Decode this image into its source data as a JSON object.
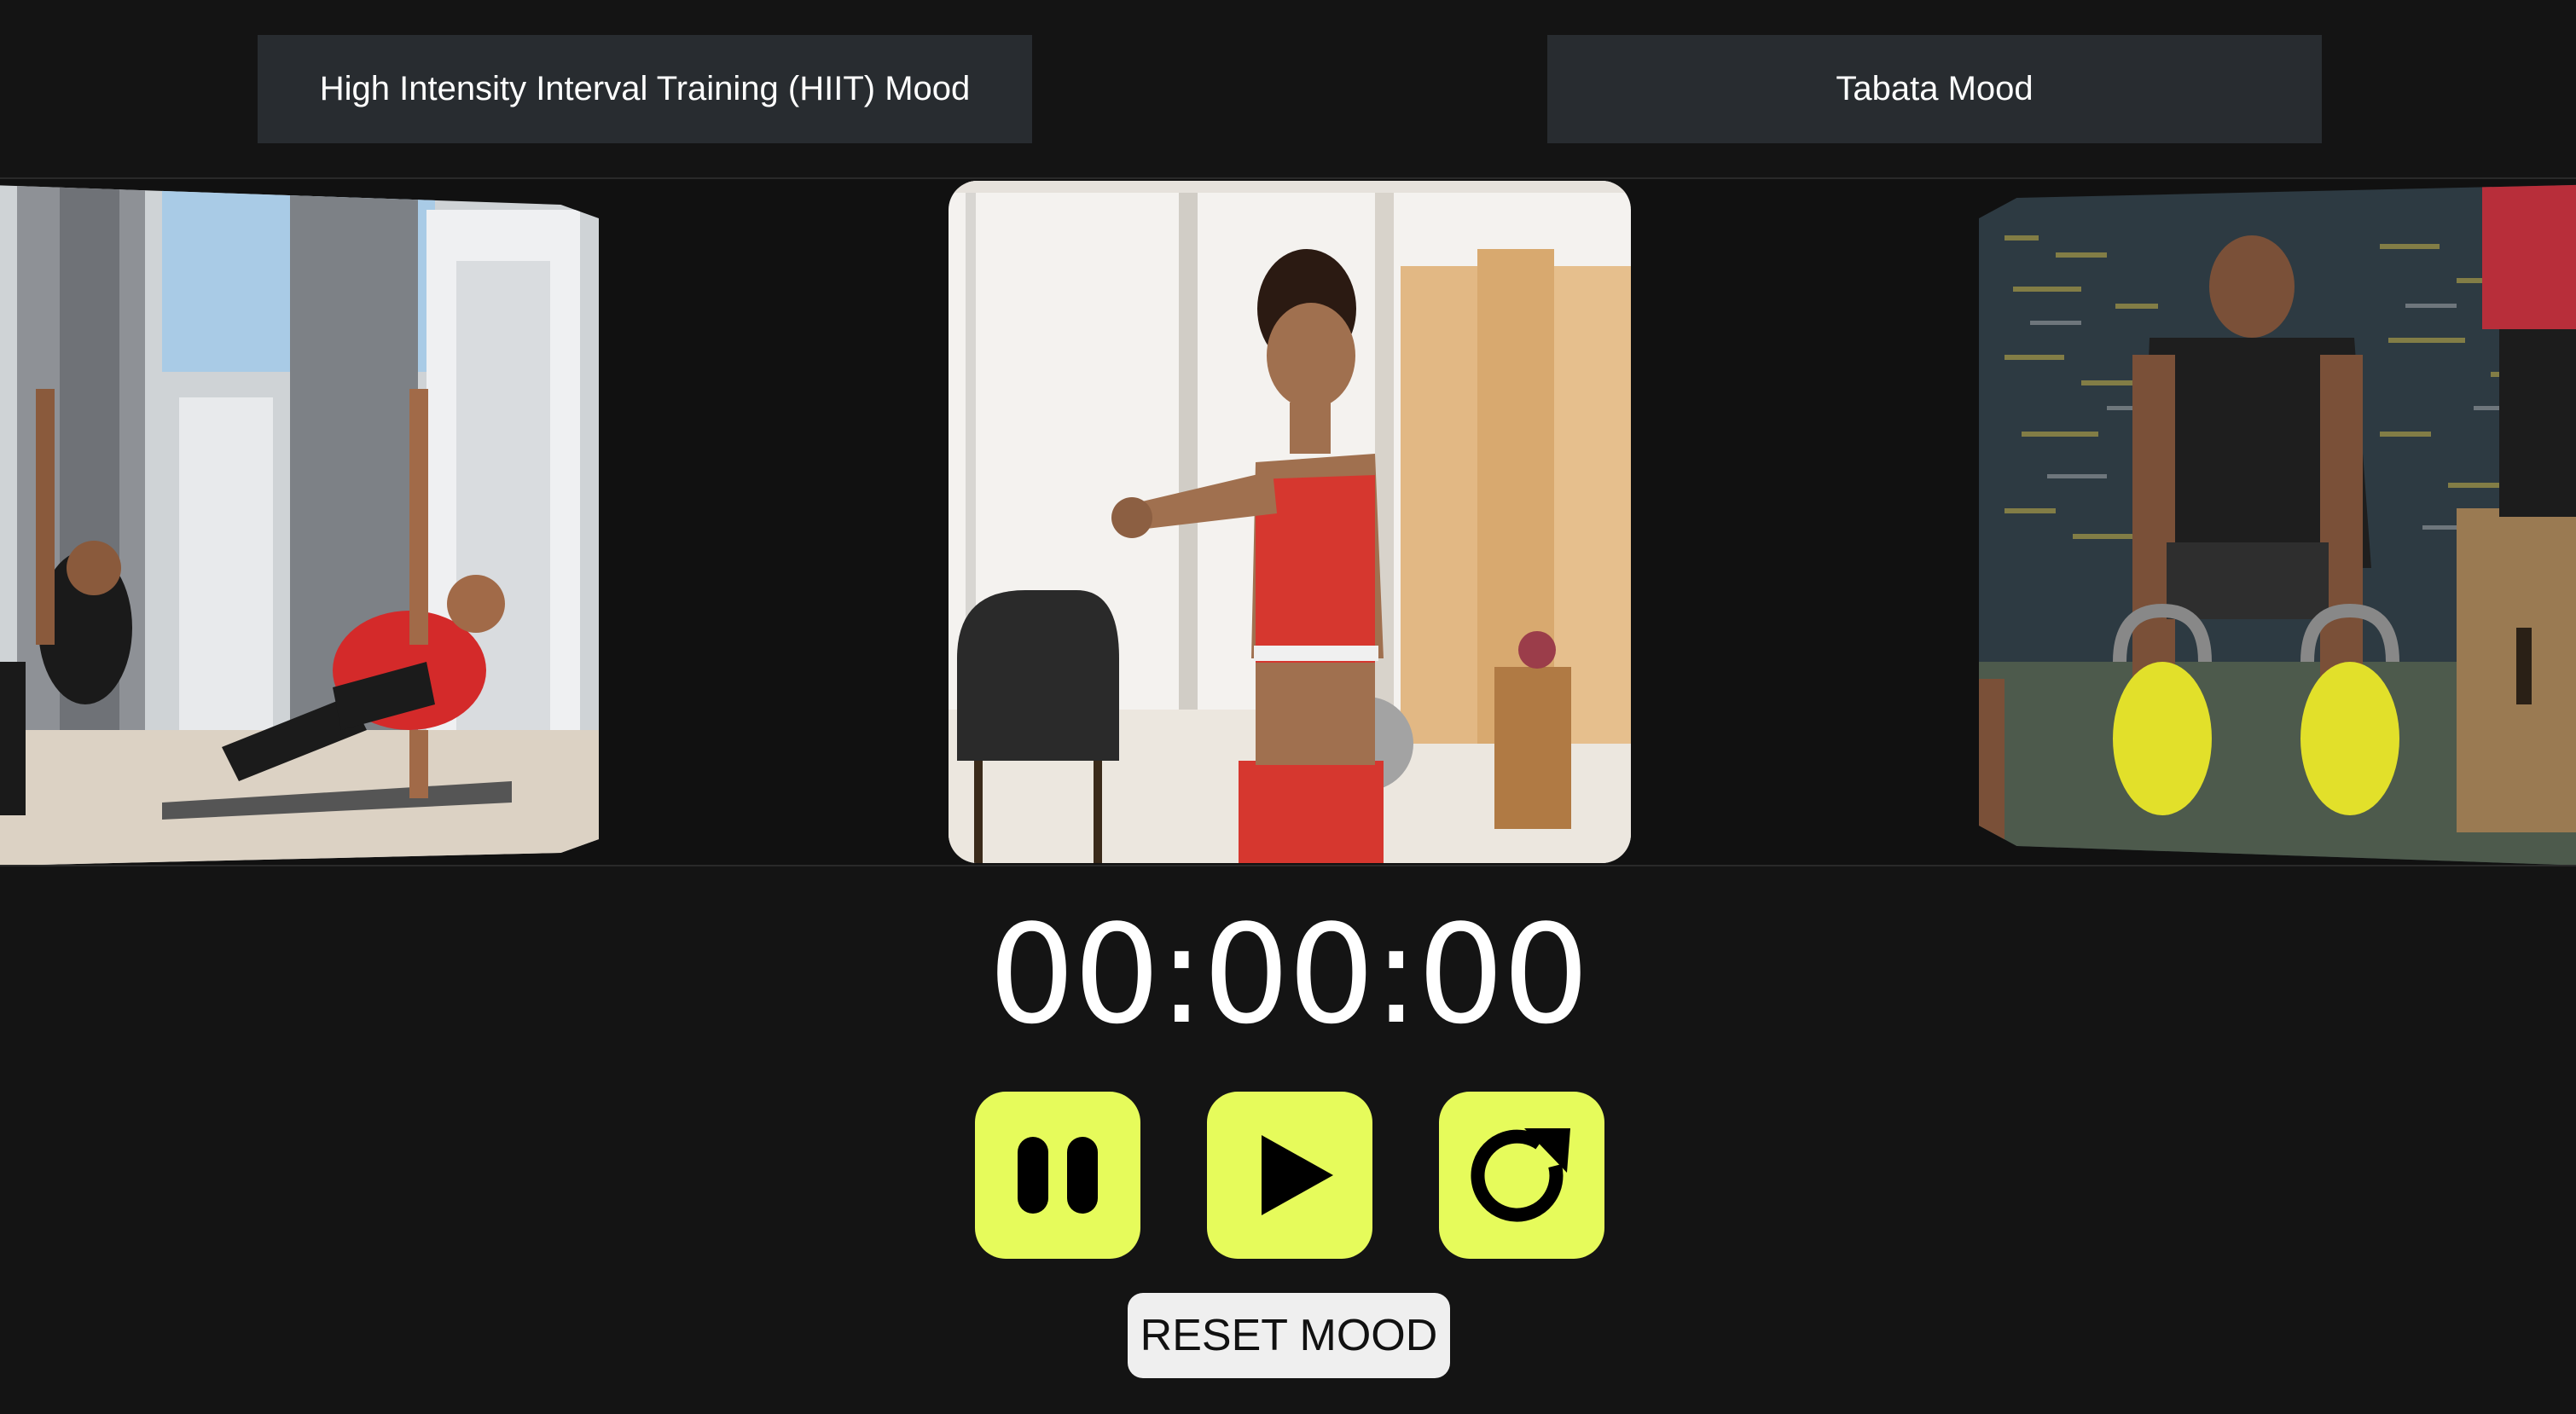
{
  "mood_buttons": {
    "hiit_label": "High Intensity Interval Training (HIIT) Mood",
    "tabata_label": "Tabata Mood"
  },
  "carousel": {
    "cards": [
      {
        "id": "left",
        "image_icon": "side-plank-workout-photo"
      },
      {
        "id": "center",
        "image_icon": "woman-stretching-workout-photo"
      },
      {
        "id": "right",
        "image_icon": "kettlebell-pushup-workout-photo"
      }
    ]
  },
  "timer": {
    "display": "00:00:00"
  },
  "controls": {
    "pause_icon": "pause-icon",
    "play_icon": "play-icon",
    "restart_icon": "restart-icon",
    "accent_color": "#e6fb5b"
  },
  "reset_mood": {
    "label": "RESET MOOD"
  }
}
